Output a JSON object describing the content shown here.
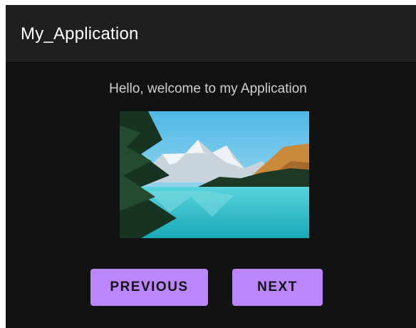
{
  "app_bar": {
    "title": "My_Application"
  },
  "main": {
    "greeting": "Hello, welcome to my Application",
    "image": {
      "subject": "mountain lake landscape photo"
    },
    "buttons": {
      "previous_label": "PREVIOUS",
      "next_label": "NEXT"
    }
  },
  "colors": {
    "background": "#121212",
    "app_bar": "#1f1f1f",
    "accent": "#bb86fc",
    "text_primary": "#ffffff",
    "text_secondary": "#cfcfcf"
  }
}
